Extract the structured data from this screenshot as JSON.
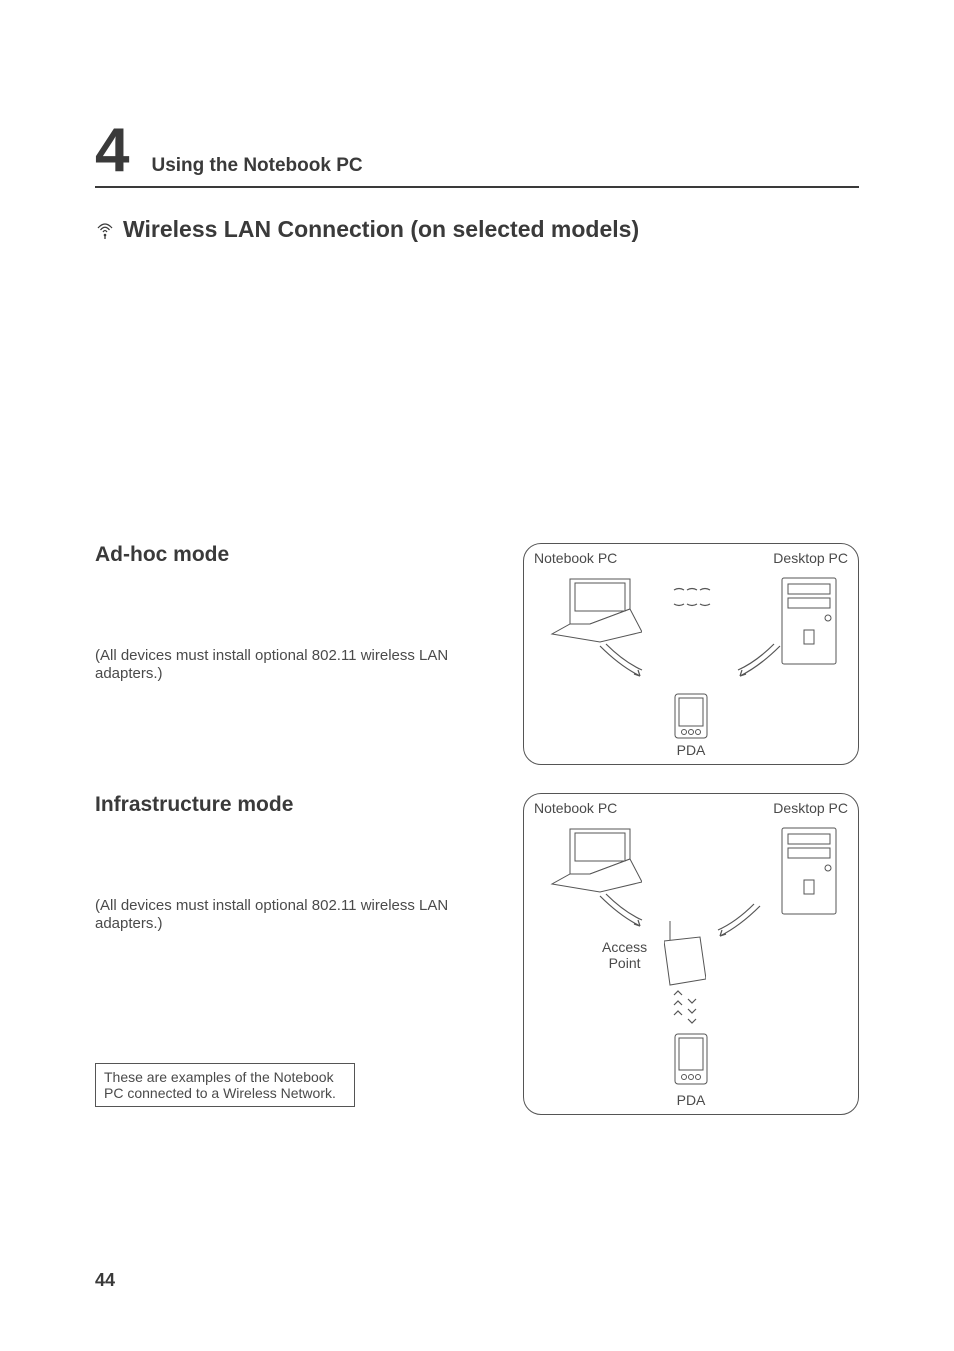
{
  "chapter": {
    "number": "4",
    "title": "Using the Notebook PC"
  },
  "section": {
    "title": "Wireless LAN Connection (on selected models)"
  },
  "adhoc": {
    "heading": "Ad-hoc mode",
    "note": "(All devices must install optional 802.11 wireless LAN adapters.)",
    "labels": {
      "notebook": "Notebook PC",
      "desktop": "Desktop PC",
      "pda": "PDA"
    }
  },
  "infra": {
    "heading": "Infrastructure mode",
    "note": "(All devices must install optional 802.11 wireless LAN adapters.)",
    "labels": {
      "notebook": "Notebook PC",
      "desktop": "Desktop PC",
      "pda": "PDA",
      "ap": "Access\nPoint"
    }
  },
  "callout": "These are examples of the Notebook PC connected to a Wireless Network.",
  "page_number": "44"
}
